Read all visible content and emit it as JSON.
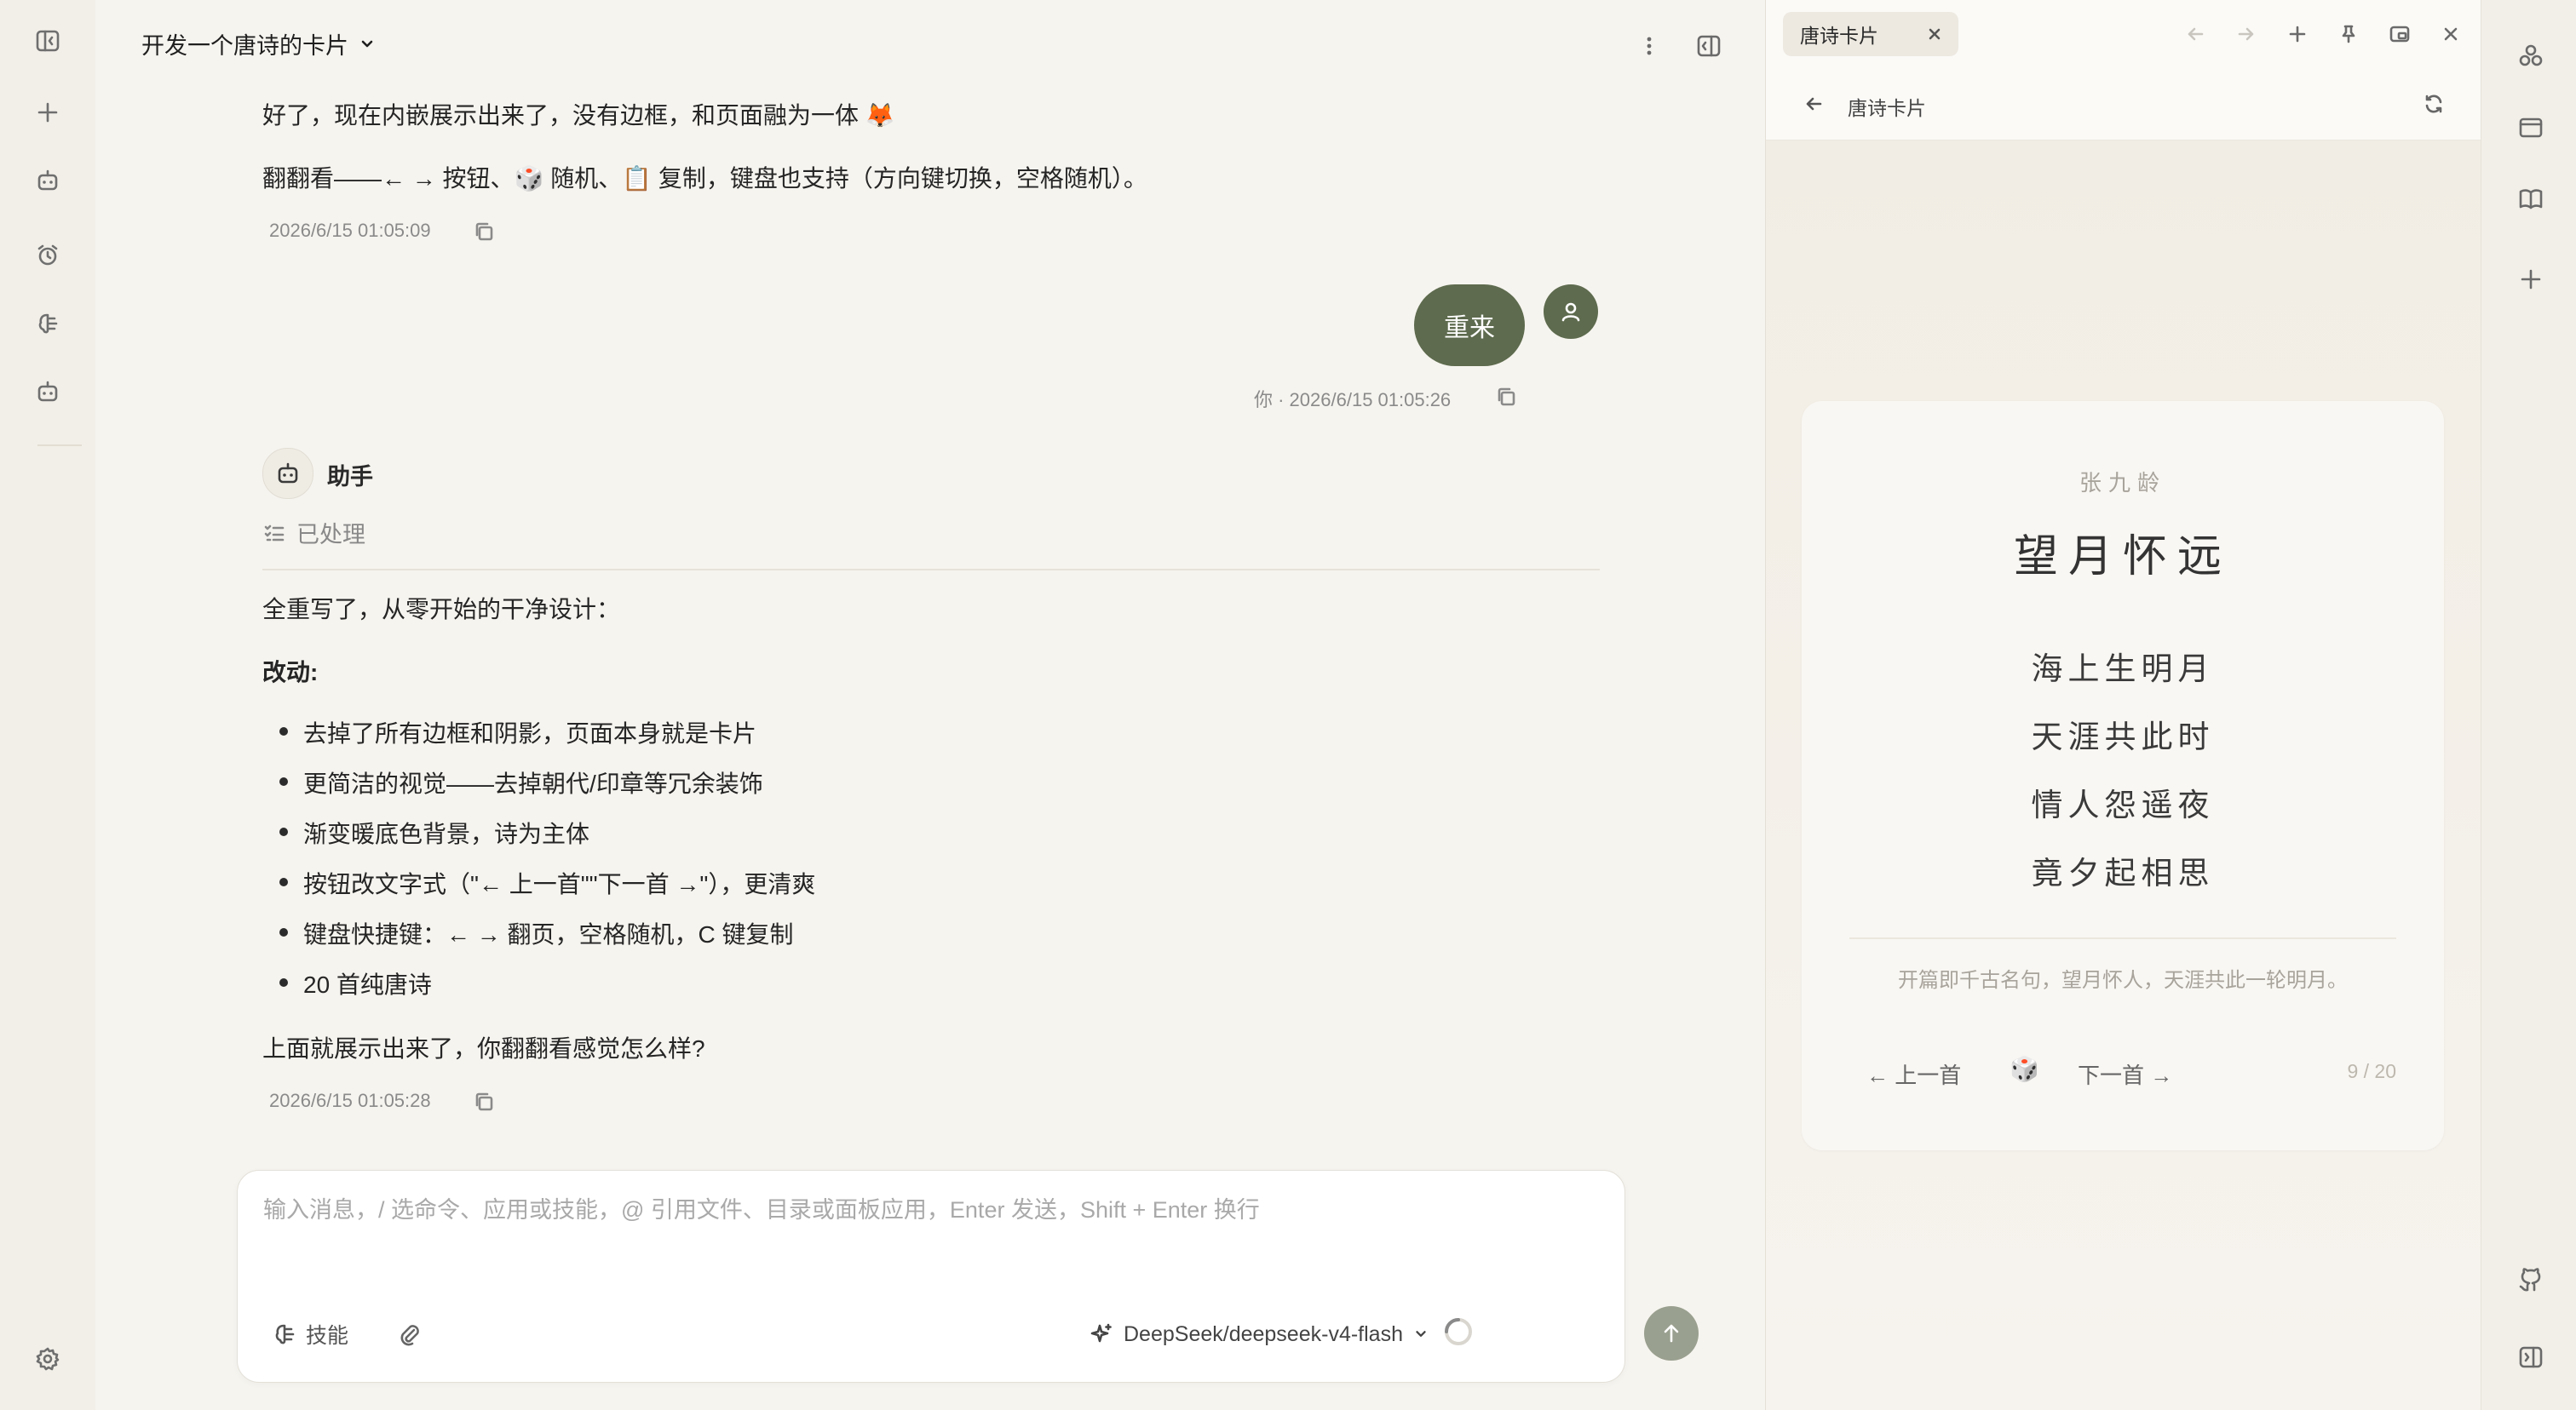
{
  "chat": {
    "title": "开发一个唐诗的卡片",
    "messages": {
      "m1_line1": "好了，现在内嵌展示出来了，没有边框，和页面融为一体 🦊",
      "m1_line2": "翻翻看——← → 按钮、🎲 随机、📋 复制，键盘也支持（方向键切换，空格随机）。",
      "m1_time": "2026/6/15 01:05:09",
      "user_text": "重来",
      "user_meta": "你 · 2026/6/15 01:05:26",
      "assistant_name": "助手",
      "processed": "已处理",
      "m2_intro": "全重写了，从零开始的干净设计：",
      "m2_heading": "改动:",
      "m2_bullets": [
        "去掉了所有边框和阴影，页面本身就是卡片",
        "更简洁的视觉——去掉朝代/印章等冗余装饰",
        "渐变暖底色背景，诗为主体",
        "按钮改文字式（\"← 上一首\"\"下一首 →\"），更清爽",
        "键盘快捷键：← → 翻页，空格随机，C 键复制",
        "20 首纯唐诗"
      ],
      "m2_outro": "上面就展示出来了，你翻翻看感觉怎么样?",
      "m2_time": "2026/6/15 01:05:28"
    }
  },
  "composer": {
    "placeholder": "输入消息，/ 选命令、应用或技能，@ 引用文件、目录或面板应用，Enter 发送，Shift + Enter 换行",
    "skills_label": "技能",
    "model": "DeepSeek/deepseek-v4-flash"
  },
  "panel": {
    "tab_label": "唐诗卡片",
    "nav_title": "唐诗卡片",
    "card": {
      "poet": "张九龄",
      "title": "望月怀远",
      "lines": [
        "海上生明月",
        "天涯共此时",
        "情人怨遥夜",
        "竟夕起相思"
      ],
      "note": "开篇即千古名句，望月怀人，天涯共此一轮明月。",
      "prev_label": "← 上一首",
      "dice": "🎲",
      "next_label": "下一首 →",
      "counter": "9 / 20"
    }
  },
  "colors": {
    "accent": "#5e6b4e",
    "send_button": "#9aa08f",
    "background": "#f6f4ef"
  }
}
